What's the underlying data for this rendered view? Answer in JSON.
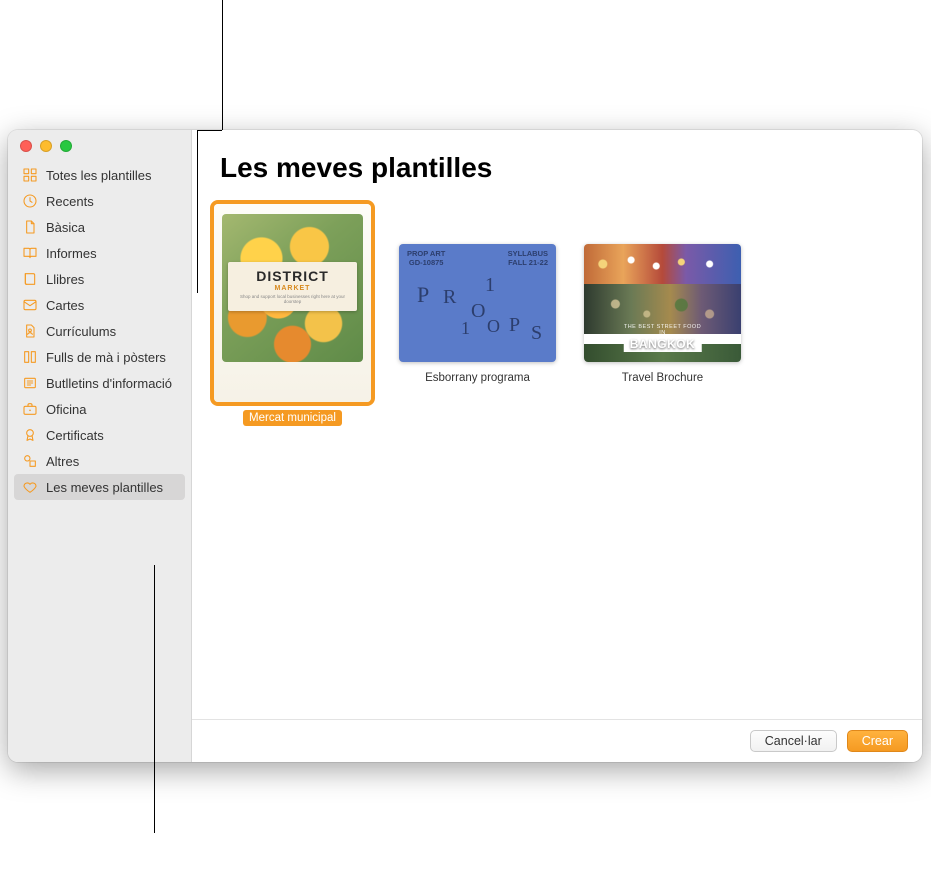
{
  "colors": {
    "accent": "#f59a22"
  },
  "header": {
    "title": "Les meves plantilles"
  },
  "sidebar": {
    "items": [
      {
        "label": "Totes les plantilles",
        "icon": "grid"
      },
      {
        "label": "Recents",
        "icon": "clock"
      },
      {
        "label": "Bàsica",
        "icon": "doc"
      },
      {
        "label": "Informes",
        "icon": "book-open"
      },
      {
        "label": "Llibres",
        "icon": "book"
      },
      {
        "label": "Cartes",
        "icon": "envelope"
      },
      {
        "label": "Currículums",
        "icon": "person-doc"
      },
      {
        "label": "Fulls de mà i pòsters",
        "icon": "columns"
      },
      {
        "label": "Butlletins d'informació",
        "icon": "news"
      },
      {
        "label": "Oficina",
        "icon": "briefcase"
      },
      {
        "label": "Certificats",
        "icon": "ribbon"
      },
      {
        "label": "Altres",
        "icon": "shapes"
      },
      {
        "label": "Les meves plantilles",
        "icon": "heart",
        "selected": true
      }
    ]
  },
  "templates": [
    {
      "name": "Mercat municipal",
      "selected": true,
      "orientation": "portrait",
      "kind": "district-market",
      "preview": {
        "title": "DISTRICT",
        "subtitle": "MARKET",
        "tagline": "Shop and support local businesses right here at your doorstep"
      }
    },
    {
      "name": "Esborrany programa",
      "selected": false,
      "orientation": "landscape",
      "kind": "props-syllabus",
      "preview": {
        "top_left_1": "PROP ART",
        "top_left_2": "GD-10875",
        "top_right_1": "SYLLABUS",
        "top_right_2": "FALL 21-22",
        "letters": "PR1O1OPS"
      }
    },
    {
      "name": "Travel Brochure",
      "selected": false,
      "orientation": "landscape",
      "kind": "bangkok",
      "preview": {
        "overline": "THE BEST STREET FOOD IN",
        "headline": "BANGKOK"
      }
    }
  ],
  "footer": {
    "cancel": "Cancel·lar",
    "create": "Crear"
  }
}
